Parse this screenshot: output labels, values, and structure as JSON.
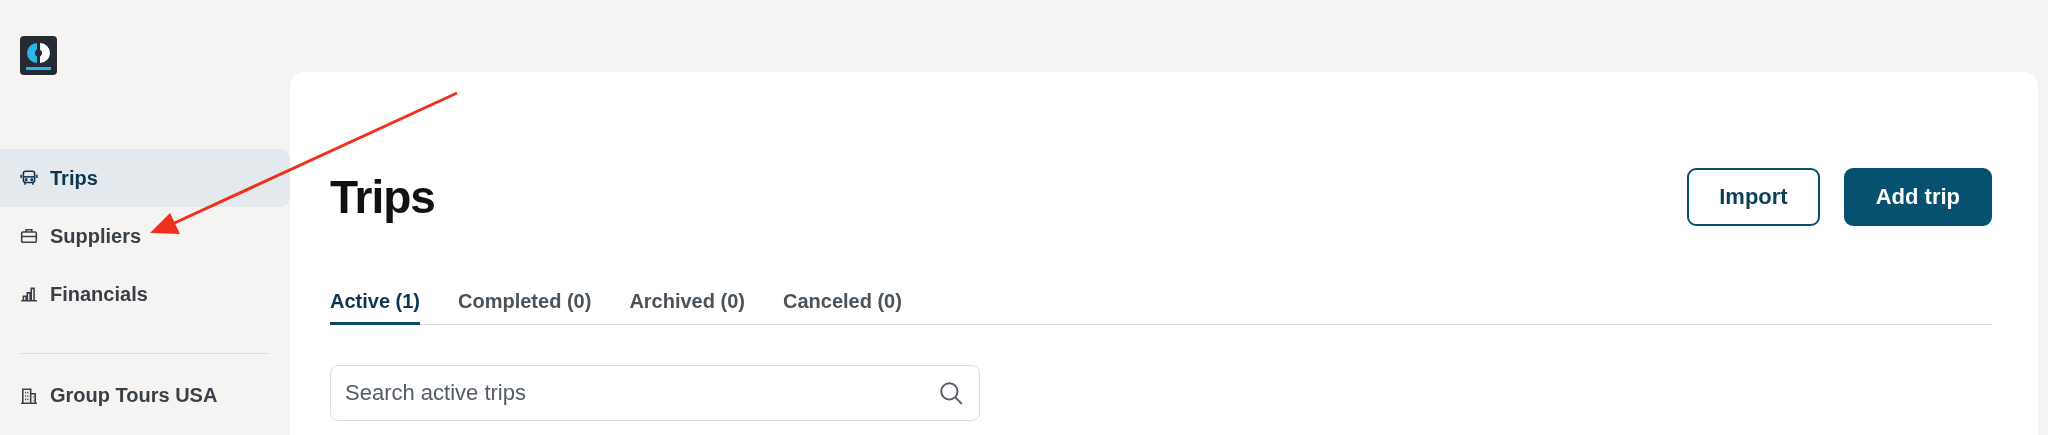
{
  "sidebar": {
    "items": [
      {
        "label": "Trips",
        "selected": true
      },
      {
        "label": "Suppliers",
        "selected": false
      },
      {
        "label": "Financials",
        "selected": false
      }
    ],
    "account": {
      "label": "Group Tours USA"
    }
  },
  "page": {
    "title": "Trips",
    "buttons": [
      {
        "label": "Import",
        "kind": "outline"
      },
      {
        "label": "Add trip",
        "kind": "primary"
      }
    ]
  },
  "tabs": [
    {
      "label": "Active (1)",
      "selected": true
    },
    {
      "label": "Completed (0)",
      "selected": false
    },
    {
      "label": "Archived (0)",
      "selected": false
    },
    {
      "label": "Canceled (0)",
      "selected": false
    }
  ],
  "search": {
    "placeholder": "Search active trips"
  }
}
